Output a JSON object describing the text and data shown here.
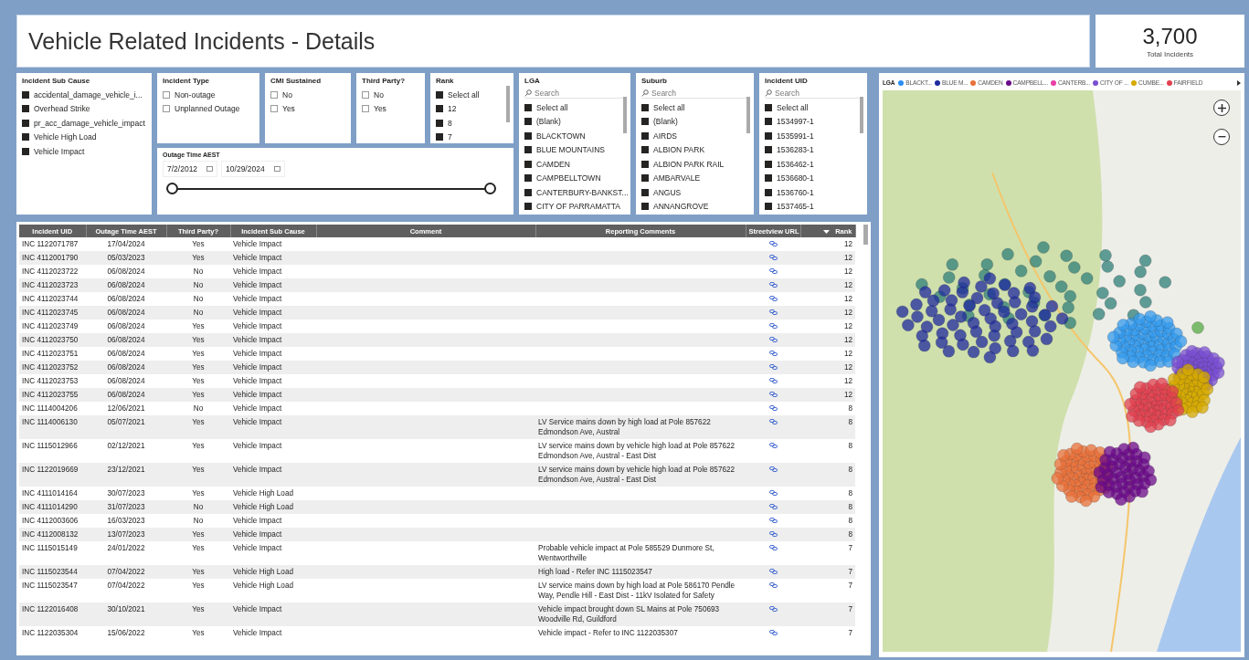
{
  "header": {
    "title": "Vehicle Related Incidents - Details"
  },
  "kpi": {
    "value": "3,700",
    "label": "Total Incidents"
  },
  "slicers": [
    {
      "kind": "list",
      "title": "Incident Sub Cause",
      "items": [
        {
          "label": "accidental_damage_vehicle_i...",
          "checked": true
        },
        {
          "label": "Overhead Strike",
          "checked": true
        },
        {
          "label": "pr_acc_damage_vehicle_impact",
          "checked": true
        },
        {
          "label": "Vehicle High Load",
          "checked": true
        },
        {
          "label": "Vehicle Impact",
          "checked": true
        }
      ]
    },
    {
      "kind": "list",
      "title": "Incident Type",
      "items": [
        {
          "label": "Non-outage",
          "checked": false
        },
        {
          "label": "Unplanned Outage",
          "checked": false
        }
      ]
    },
    {
      "kind": "list",
      "title": "CMI Sustained",
      "items": [
        {
          "label": "No",
          "checked": false
        },
        {
          "label": "Yes",
          "checked": false
        }
      ]
    },
    {
      "kind": "list",
      "title": "Third Party?",
      "items": [
        {
          "label": "No",
          "checked": false
        },
        {
          "label": "Yes",
          "checked": false
        }
      ]
    },
    {
      "kind": "list",
      "title": "Rank",
      "scrollable": true,
      "items": [
        {
          "label": "Select all",
          "checked": true
        },
        {
          "label": "12",
          "checked": true
        },
        {
          "label": "8",
          "checked": true
        },
        {
          "label": "7",
          "checked": true
        }
      ]
    },
    {
      "kind": "list",
      "title": "LGA",
      "scrollable": true,
      "search": {
        "placeholder": "Search"
      },
      "items": [
        {
          "label": "Select all",
          "checked": true
        },
        {
          "label": "(Blank)",
          "checked": true
        },
        {
          "label": "BLACKTOWN",
          "checked": true
        },
        {
          "label": "BLUE MOUNTAINS",
          "checked": true
        },
        {
          "label": "CAMDEN",
          "checked": true
        },
        {
          "label": "CAMPBELLTOWN",
          "checked": true
        },
        {
          "label": "CANTERBURY-BANKST...",
          "checked": true
        },
        {
          "label": "CITY OF PARRAMATTA",
          "checked": true
        }
      ]
    },
    {
      "kind": "list",
      "title": "Suburb",
      "scrollable": true,
      "search": {
        "placeholder": "Search"
      },
      "items": [
        {
          "label": "Select all",
          "checked": true
        },
        {
          "label": "(Blank)",
          "checked": true
        },
        {
          "label": "AIRDS",
          "checked": true
        },
        {
          "label": "ALBION PARK",
          "checked": true
        },
        {
          "label": "ALBION PARK RAIL",
          "checked": true
        },
        {
          "label": "AMBARVALE",
          "checked": true
        },
        {
          "label": "ANGUS",
          "checked": true
        },
        {
          "label": "ANNANGROVE",
          "checked": true
        }
      ]
    },
    {
      "kind": "list",
      "title": "Incident UID",
      "scrollable": true,
      "search": {
        "placeholder": "Search"
      },
      "items": [
        {
          "label": "Select all",
          "checked": true
        },
        {
          "label": "1534997-1",
          "checked": true
        },
        {
          "label": "1535991-1",
          "checked": true
        },
        {
          "label": "1536283-1",
          "checked": true
        },
        {
          "label": "1536462-1",
          "checked": true
        },
        {
          "label": "1536680-1",
          "checked": true
        },
        {
          "label": "1536760-1",
          "checked": true
        },
        {
          "label": "1537465-1",
          "checked": true
        }
      ]
    },
    {
      "kind": "date-range",
      "title": "Outage Time AEST",
      "start": "7/2/2012",
      "end": "10/29/2024",
      "thumbs": [
        {
          "level": 0
        },
        {
          "level": 1
        }
      ]
    }
  ],
  "table": {
    "columns": [
      "Incident UID",
      "Outage Time AEST",
      "Third Party?",
      "Incident Sub Cause",
      "Comment",
      "Reporting Comments",
      "Streetview URL",
      "Rank"
    ],
    "rows": [
      {
        "uid": "INC 1122071787",
        "time": "17/04/2024",
        "third_party": "Yes",
        "sub_cause": "Vehicle Impact",
        "rank": "12"
      },
      {
        "uid": "INC 4112001790",
        "time": "05/03/2023",
        "third_party": "Yes",
        "sub_cause": "Vehicle Impact",
        "rank": "12"
      },
      {
        "uid": "INC 4112023722",
        "time": "06/08/2024",
        "third_party": "No",
        "sub_cause": "Vehicle Impact",
        "rank": "12"
      },
      {
        "uid": "INC 4112023723",
        "time": "06/08/2024",
        "third_party": "No",
        "sub_cause": "Vehicle Impact",
        "rank": "12"
      },
      {
        "uid": "INC 4112023744",
        "time": "06/08/2024",
        "third_party": "No",
        "sub_cause": "Vehicle Impact",
        "rank": "12"
      },
      {
        "uid": "INC 4112023745",
        "time": "06/08/2024",
        "third_party": "No",
        "sub_cause": "Vehicle Impact",
        "rank": "12"
      },
      {
        "uid": "INC 4112023749",
        "time": "06/08/2024",
        "third_party": "Yes",
        "sub_cause": "Vehicle Impact",
        "rank": "12"
      },
      {
        "uid": "INC 4112023750",
        "time": "06/08/2024",
        "third_party": "Yes",
        "sub_cause": "Vehicle Impact",
        "rank": "12"
      },
      {
        "uid": "INC 4112023751",
        "time": "06/08/2024",
        "third_party": "Yes",
        "sub_cause": "Vehicle Impact",
        "rank": "12"
      },
      {
        "uid": "INC 4112023752",
        "time": "06/08/2024",
        "third_party": "Yes",
        "sub_cause": "Vehicle Impact",
        "rank": "12"
      },
      {
        "uid": "INC 4112023753",
        "time": "06/08/2024",
        "third_party": "Yes",
        "sub_cause": "Vehicle Impact",
        "rank": "12"
      },
      {
        "uid": "INC 4112023755",
        "time": "06/08/2024",
        "third_party": "Yes",
        "sub_cause": "Vehicle Impact",
        "rank": "12"
      },
      {
        "uid": "INC 1114004206",
        "time": "12/06/2021",
        "third_party": "No",
        "sub_cause": "Vehicle Impact",
        "rank": "8"
      },
      {
        "uid": "INC 1114006130",
        "time": "05/07/2021",
        "third_party": "Yes",
        "sub_cause": "Vehicle Impact",
        "reporting": "LV Service mains down by high load at Pole 857622 Edmondson Ave, Austral",
        "rank": "8"
      },
      {
        "uid": "INC 1115012966",
        "time": "02/12/2021",
        "third_party": "Yes",
        "sub_cause": "Vehicle Impact",
        "reporting": "LV service mains down by vehicle high load at Pole 857622 Edmondson Ave, Austral - East Dist",
        "rank": "8"
      },
      {
        "uid": "INC 1122019669",
        "time": "23/12/2021",
        "third_party": "Yes",
        "sub_cause": "Vehicle Impact",
        "reporting": "LV service mains down by vehicle high load at Pole 857622 Edmondson Ave, Austral - East Dist",
        "rank": "8"
      },
      {
        "uid": "INC 4111014164",
        "time": "30/07/2023",
        "third_party": "Yes",
        "sub_cause": "Vehicle High Load",
        "rank": "8"
      },
      {
        "uid": "INC 4111014290",
        "time": "31/07/2023",
        "third_party": "No",
        "sub_cause": "Vehicle High Load",
        "rank": "8"
      },
      {
        "uid": "INC 4112003606",
        "time": "16/03/2023",
        "third_party": "No",
        "sub_cause": "Vehicle Impact",
        "rank": "8"
      },
      {
        "uid": "INC 4112008132",
        "time": "13/07/2023",
        "third_party": "Yes",
        "sub_cause": "Vehicle Impact",
        "rank": "8"
      },
      {
        "uid": "INC 1115015149",
        "time": "24/01/2022",
        "third_party": "Yes",
        "sub_cause": "Vehicle Impact",
        "reporting": "Probable vehicle impact at Pole 585529 Dunmore St, Wentworthville",
        "rank": "7"
      },
      {
        "uid": "INC 1115023544",
        "time": "07/04/2022",
        "third_party": "Yes",
        "sub_cause": "Vehicle High Load",
        "reporting": "High load - Refer INC 1115023547",
        "rank": "7"
      },
      {
        "uid": "INC 1115023547",
        "time": "07/04/2022",
        "third_party": "Yes",
        "sub_cause": "Vehicle High Load",
        "reporting": "LV service mains down by high load at Pole 586170 Pendle Way, Pendle Hill - East Dist - 11kV Isolated for Safety",
        "rank": "7"
      },
      {
        "uid": "INC 1122016408",
        "time": "30/10/2021",
        "third_party": "Yes",
        "sub_cause": "Vehicle Impact",
        "reporting": "Vehicle impact brought down SL Mains at Pole 750693 Woodville Rd, Guildford",
        "rank": "7"
      },
      {
        "uid": "INC 1122035304",
        "time": "15/06/2022",
        "third_party": "Yes",
        "sub_cause": "Vehicle Impact",
        "reporting": "Vehicle impact - Refer to INC 1122035307",
        "rank": "7"
      }
    ]
  },
  "map": {
    "legend_title": "LGA",
    "legend": [
      {
        "name": "BLACKT...",
        "color": "#2b8ef0"
      },
      {
        "name": "BLUE M...",
        "color": "#1f2a9e"
      },
      {
        "name": "CAMDEN",
        "color": "#e8703a"
      },
      {
        "name": "CAMPBELL...",
        "color": "#6b0a8a"
      },
      {
        "name": "CANTERB...",
        "color": "#e83fa6"
      },
      {
        "name": "CITY OF ...",
        "color": "#7a4fd1"
      },
      {
        "name": "CUMBE...",
        "color": "#d6aa00"
      },
      {
        "name": "FAIRFIELD",
        "color": "#e0404f"
      }
    ]
  }
}
